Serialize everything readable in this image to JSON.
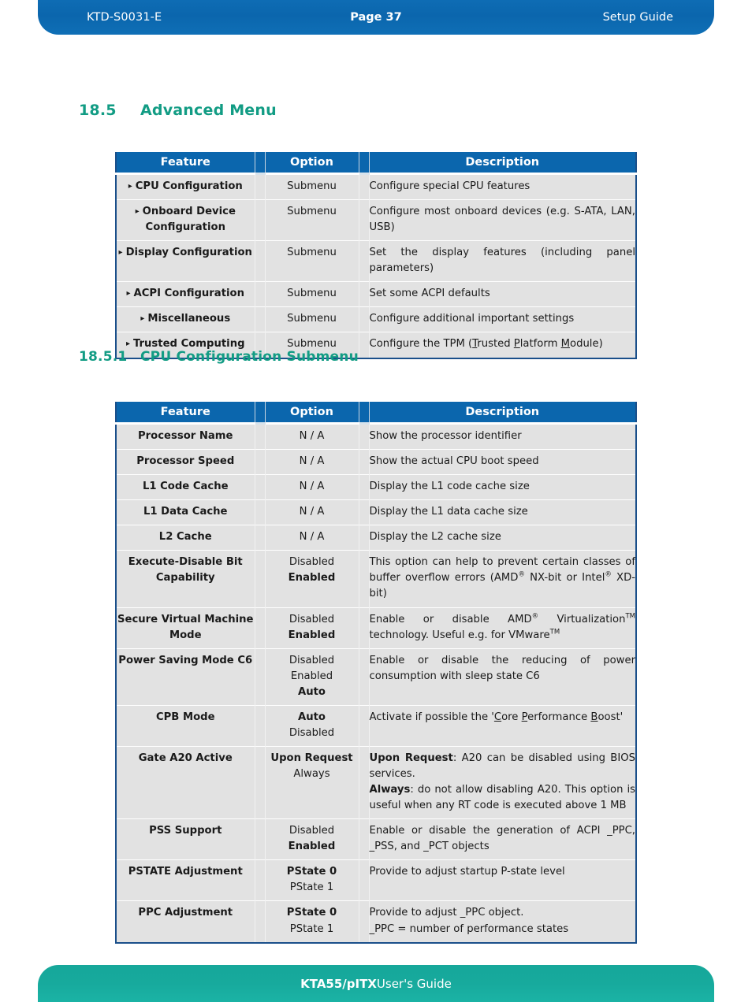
{
  "header": {
    "left": "KTD-S0031-E",
    "center": "Page 37",
    "right": "Setup Guide"
  },
  "footer": {
    "title_bold": "KTA55/pITX",
    "title_rest": " User's Guide"
  },
  "section": {
    "number": "18.5",
    "title": "Advanced Menu"
  },
  "subsection": {
    "number": "18.5.1",
    "title": "CPU Configuration Submenu"
  },
  "table_headers": {
    "feature": "Feature",
    "option": "Option",
    "description": "Description"
  },
  "advanced_menu_rows": [
    {
      "feature": "CPU Configuration",
      "options": [
        "Submenu"
      ],
      "description": "Configure special CPU features"
    },
    {
      "feature": "Onboard Device Configuration",
      "options": [
        "Submenu"
      ],
      "description": "Configure most onboard devices (e.g. S-ATA, LAN, USB)"
    },
    {
      "feature": "Display Configuration",
      "options": [
        "Submenu"
      ],
      "description": "Set the display features (including panel parameters)"
    },
    {
      "feature": "ACPI Configuration",
      "options": [
        "Submenu"
      ],
      "description": "Set some ACPI defaults"
    },
    {
      "feature": "Miscellaneous",
      "options": [
        "Submenu"
      ],
      "description": "Configure additional important settings"
    },
    {
      "feature": "Trusted Computing",
      "options": [
        "Submenu"
      ],
      "description": "Configure the TPM (Trusted Platform Module)"
    }
  ],
  "cpu_submenu_rows": [
    {
      "feature": "Processor Name",
      "options": [
        "N / A"
      ],
      "description": "Show the processor identifier"
    },
    {
      "feature": "Processor Speed",
      "options": [
        "N / A"
      ],
      "description": "Show the actual CPU boot speed"
    },
    {
      "feature": "L1 Code Cache",
      "options": [
        "N / A"
      ],
      "description": "Display the L1 code cache size"
    },
    {
      "feature": "L1 Data Cache",
      "options": [
        "N / A"
      ],
      "description": "Display the L1 data cache size"
    },
    {
      "feature": "L2 Cache",
      "options": [
        "N / A"
      ],
      "description": "Display the L2 cache size"
    },
    {
      "feature": "Execute-Disable Bit Capability",
      "options": [
        "Disabled",
        "Enabled"
      ],
      "default": "Enabled",
      "description": "This option can help to prevent certain classes of buffer overflow errors (AMD® NX-bit or Intel® XD-bit)"
    },
    {
      "feature": "Secure Virtual Machine Mode",
      "options": [
        "Disabled",
        "Enabled"
      ],
      "default": "Enabled",
      "description": "Enable or disable AMD® Virtualization™ technology. Useful e.g. for VMware™"
    },
    {
      "feature": "Power Saving Mode C6",
      "options": [
        "Disabled",
        "Enabled",
        "Auto"
      ],
      "default": "Auto",
      "description": "Enable or disable the reducing of power consumption with sleep state C6"
    },
    {
      "feature": "CPB Mode",
      "options": [
        "Auto",
        "Disabled"
      ],
      "default": "Auto",
      "description": "Activate if possible the 'Core Performance Boost'"
    },
    {
      "feature": "Gate A20 Active",
      "options": [
        "Upon Request",
        "Always"
      ],
      "default": "Upon Request",
      "description": "Upon Request: A20 can be disabled using BIOS services. Always: do not allow disabling A20. This option is useful when any RT code is executed above 1 MB"
    },
    {
      "feature": "PSS Support",
      "options": [
        "Disabled",
        "Enabled"
      ],
      "default": "Enabled",
      "description": "Enable or disable the generation of ACPI _PPC, _PSS, and _PCT objects"
    },
    {
      "feature": "PSTATE Adjustment",
      "options": [
        "PState 0",
        "PState 1"
      ],
      "default": "PState 0",
      "description": "Provide to adjust startup P-state level"
    },
    {
      "feature": "PPC Adjustment",
      "options": [
        "PState 0",
        "PState 1"
      ],
      "default": "PState 0",
      "description": "Provide to adjust _PPC object. _PPC = number of performance states"
    }
  ],
  "colors": {
    "header_blue": "#0b66ad",
    "footer_teal": "#17aa9d",
    "heading_teal": "#129c84",
    "feature_blue": "#0b5fa5",
    "row_gray": "#e2e2e2",
    "table_border": "#1a4f8a"
  },
  "icons": {
    "bullet": "▸"
  }
}
